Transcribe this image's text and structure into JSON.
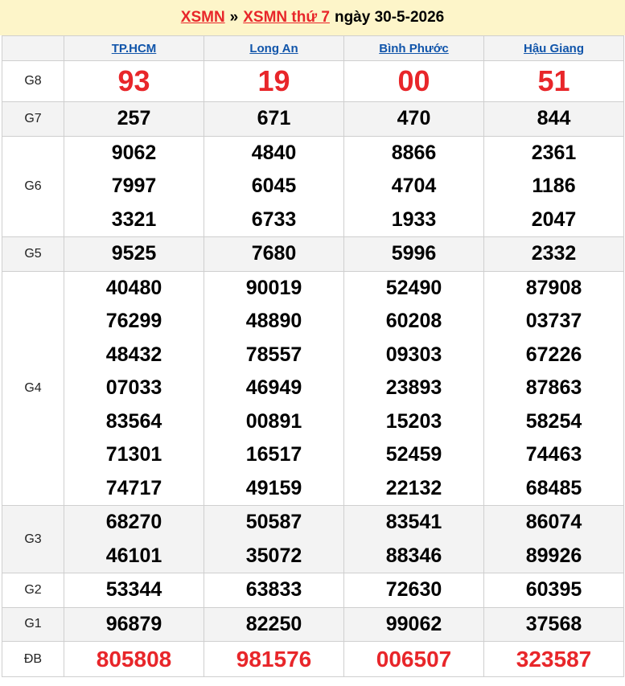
{
  "header": {
    "link1": "XSMN",
    "separator": "»",
    "link2": "XSMN thứ 7",
    "date_text": "ngày 30-5-2026"
  },
  "provinces": [
    "TP.HCM",
    "Long An",
    "Bình Phước",
    "Hậu Giang"
  ],
  "accent_color": "#e8262a",
  "link_color": "#1155aa",
  "prizes": [
    {
      "label": "G8",
      "values": [
        [
          "93"
        ],
        [
          "19"
        ],
        [
          "00"
        ],
        [
          "51"
        ]
      ]
    },
    {
      "label": "G7",
      "values": [
        [
          "257"
        ],
        [
          "671"
        ],
        [
          "470"
        ],
        [
          "844"
        ]
      ]
    },
    {
      "label": "G6",
      "values": [
        [
          "9062",
          "7997",
          "3321"
        ],
        [
          "4840",
          "6045",
          "6733"
        ],
        [
          "8866",
          "4704",
          "1933"
        ],
        [
          "2361",
          "1186",
          "2047"
        ]
      ]
    },
    {
      "label": "G5",
      "values": [
        [
          "9525"
        ],
        [
          "7680"
        ],
        [
          "5996"
        ],
        [
          "2332"
        ]
      ]
    },
    {
      "label": "G4",
      "values": [
        [
          "40480",
          "76299",
          "48432",
          "07033",
          "83564",
          "71301",
          "74717"
        ],
        [
          "90019",
          "48890",
          "78557",
          "46949",
          "00891",
          "16517",
          "49159"
        ],
        [
          "52490",
          "60208",
          "09303",
          "23893",
          "15203",
          "52459",
          "22132"
        ],
        [
          "87908",
          "03737",
          "67226",
          "87863",
          "58254",
          "74463",
          "68485"
        ]
      ]
    },
    {
      "label": "G3",
      "values": [
        [
          "68270",
          "46101"
        ],
        [
          "50587",
          "35072"
        ],
        [
          "83541",
          "88346"
        ],
        [
          "86074",
          "89926"
        ]
      ]
    },
    {
      "label": "G2",
      "values": [
        [
          "53344"
        ],
        [
          "63833"
        ],
        [
          "72630"
        ],
        [
          "60395"
        ]
      ]
    },
    {
      "label": "G1",
      "values": [
        [
          "96879"
        ],
        [
          "82250"
        ],
        [
          "99062"
        ],
        [
          "37568"
        ]
      ]
    },
    {
      "label": "ĐB",
      "values": [
        [
          "805808"
        ],
        [
          "981576"
        ],
        [
          "006507"
        ],
        [
          "323587"
        ]
      ]
    }
  ]
}
